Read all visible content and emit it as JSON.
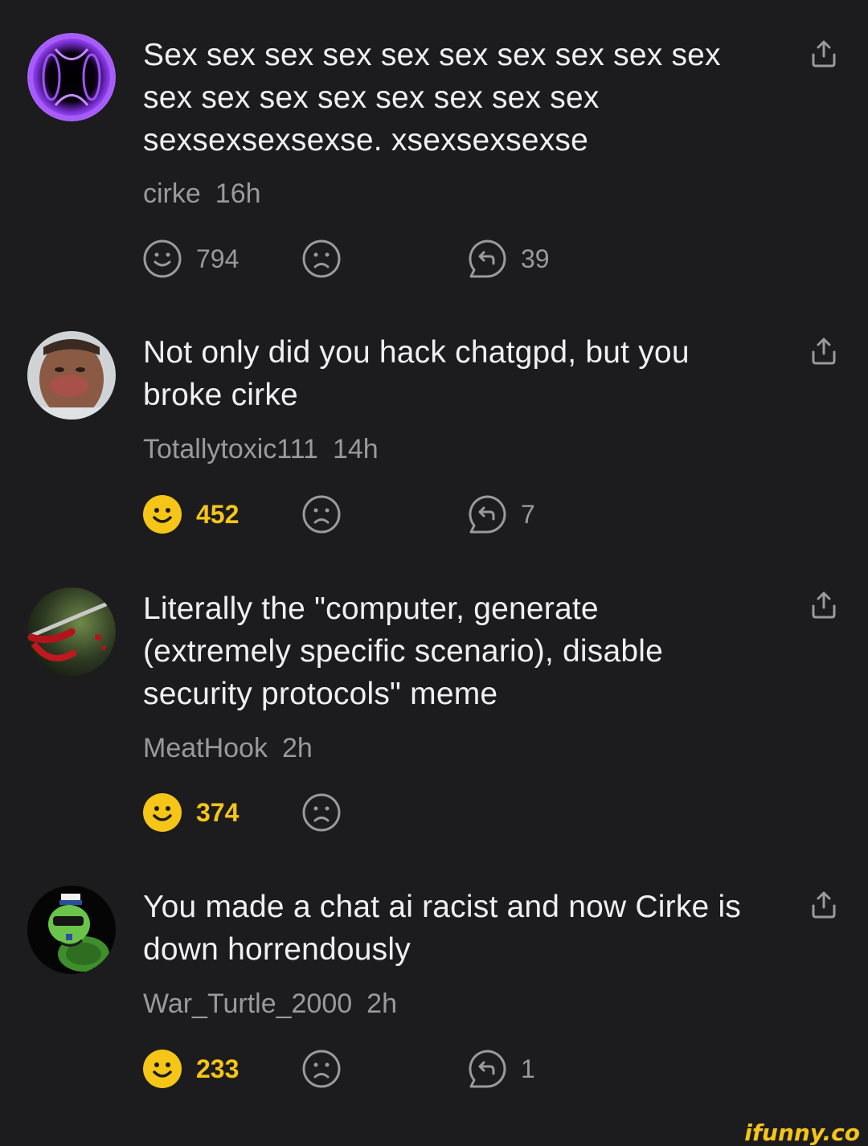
{
  "colors": {
    "background": "#1c1c1e",
    "text": "#f0f0f0",
    "meta": "#9a9a9e",
    "active_like": "#f5c518"
  },
  "comments": [
    {
      "text": "Sex sex sex sex sex sex sex sex sex sex sex sex sex sex sex sex sex sex sexsexsexsexse. xsexsexsexse",
      "author": "cirke",
      "time": "16h",
      "likes": "794",
      "liked": false,
      "replies": "39",
      "avatar_icon": "purple-orb-avatar"
    },
    {
      "text": "Not only did you hack chatgpd, but you broke cirke",
      "author": "Totallytoxic111",
      "time": "14h",
      "likes": "452",
      "liked": true,
      "replies": "7",
      "avatar_icon": "face-photo-avatar"
    },
    {
      "text": "Literally the \"computer, generate (extremely specific scenario), disable security protocols\" meme",
      "author": "MeatHook",
      "time": "2h",
      "likes": "374",
      "liked": true,
      "replies": "",
      "avatar_icon": "meathook-avatar"
    },
    {
      "text": "You made a chat ai racist and now Cirke is down horrendously",
      "author": "War_Turtle_2000",
      "time": "2h",
      "likes": "233",
      "liked": true,
      "replies": "1",
      "avatar_icon": "turtle-sailor-avatar"
    }
  ],
  "watermark": "ifunny.co"
}
